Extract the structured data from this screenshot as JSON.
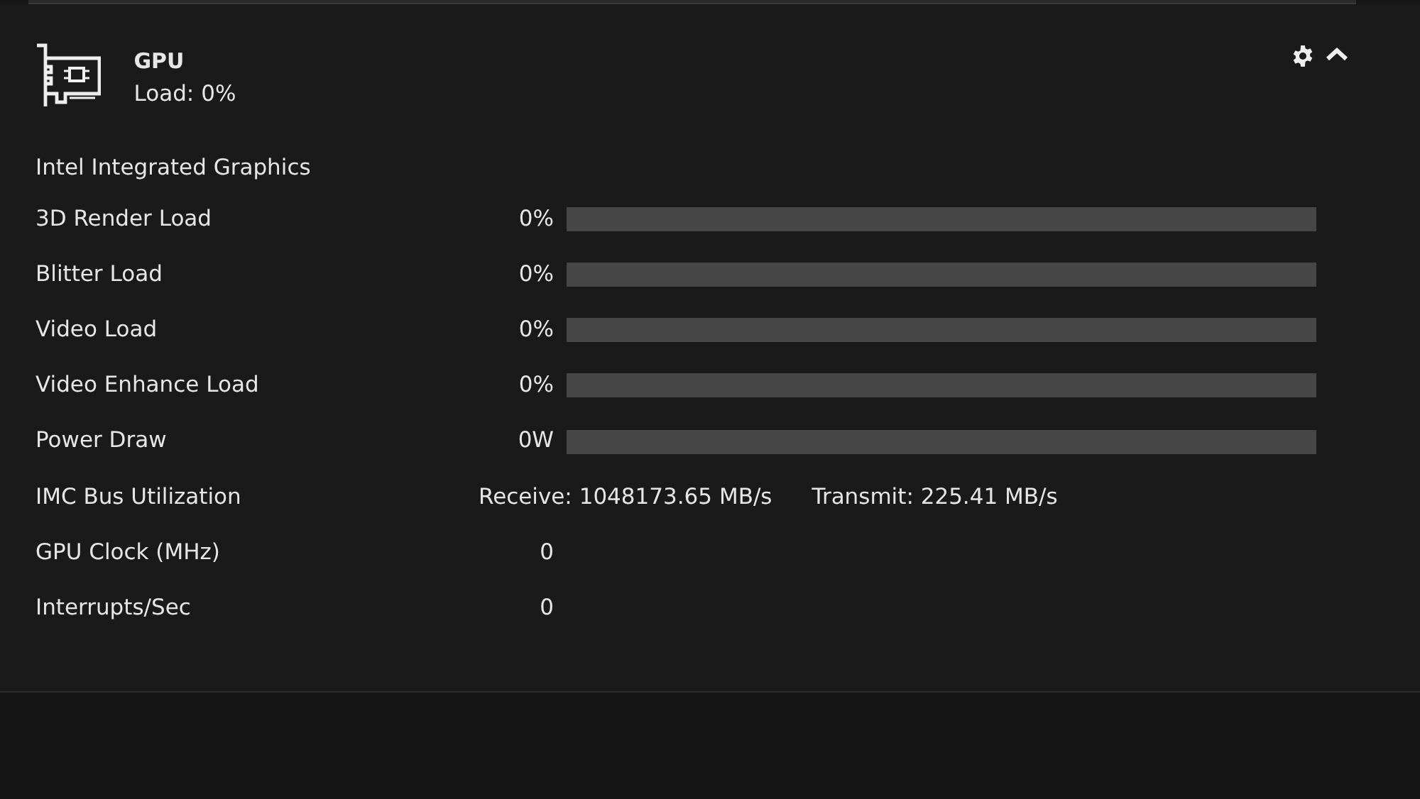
{
  "header": {
    "title": "GPU",
    "subtitle": "Load: 0%"
  },
  "device": "Intel Integrated Graphics",
  "metrics": [
    {
      "kind": "bar",
      "label": "3D Render Load",
      "value": "0%",
      "level": 0
    },
    {
      "kind": "bar",
      "label": "Blitter Load",
      "value": "0%",
      "level": 0
    },
    {
      "kind": "bar",
      "label": "Video Load",
      "value": "0%",
      "level": 0
    },
    {
      "kind": "bar",
      "label": "Video Enhance Load",
      "value": "0%",
      "level": 0
    },
    {
      "kind": "bar",
      "label": "Power Draw",
      "value": "0W",
      "level": 0
    },
    {
      "kind": "pair",
      "label": "IMC Bus Utilization",
      "value": "Receive: 1048173.65 MB/s",
      "value_2": "Transmit: 225.41 MB/s"
    },
    {
      "kind": "plain",
      "label": "GPU Clock (MHz)",
      "value": "0"
    },
    {
      "kind": "plain",
      "label": "Interrupts/Sec",
      "value": "0"
    }
  ]
}
